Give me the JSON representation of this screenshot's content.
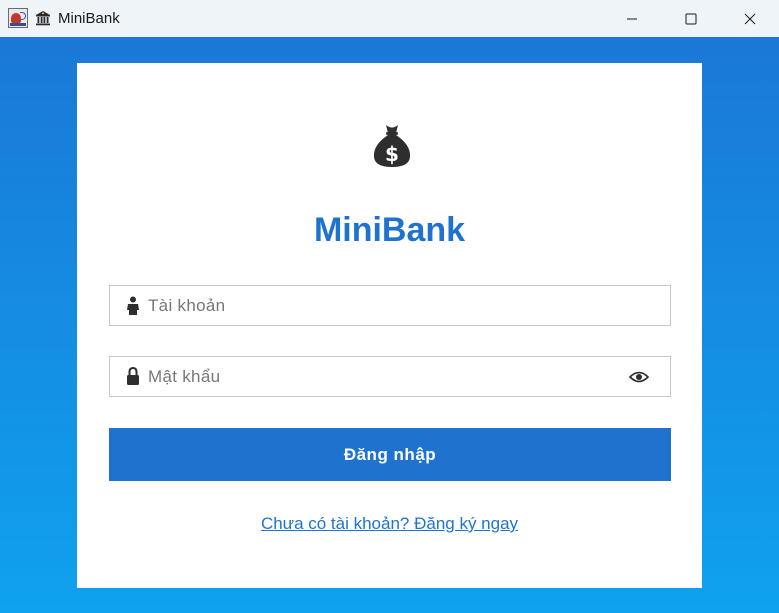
{
  "window": {
    "title": "MiniBank"
  },
  "login": {
    "brand": "MiniBank",
    "username_placeholder": "Tài khoản",
    "username_value": "",
    "password_placeholder": "Mật khẩu",
    "password_value": "",
    "login_button": "Đăng nhập",
    "register_link": "Chưa có tài khoản? Đăng ký ngay"
  },
  "icons": {
    "app": "java-coffee-cup-icon",
    "title_logo": "bank-building-icon",
    "logo": "money-bag-icon",
    "username": "person-icon",
    "password": "lock-icon",
    "toggle_password": "eye-icon"
  },
  "colors": {
    "accent": "#1f73cf",
    "background_top": "#1a78d6",
    "background_bottom": "#0fa2ee",
    "card": "#ffffff"
  }
}
